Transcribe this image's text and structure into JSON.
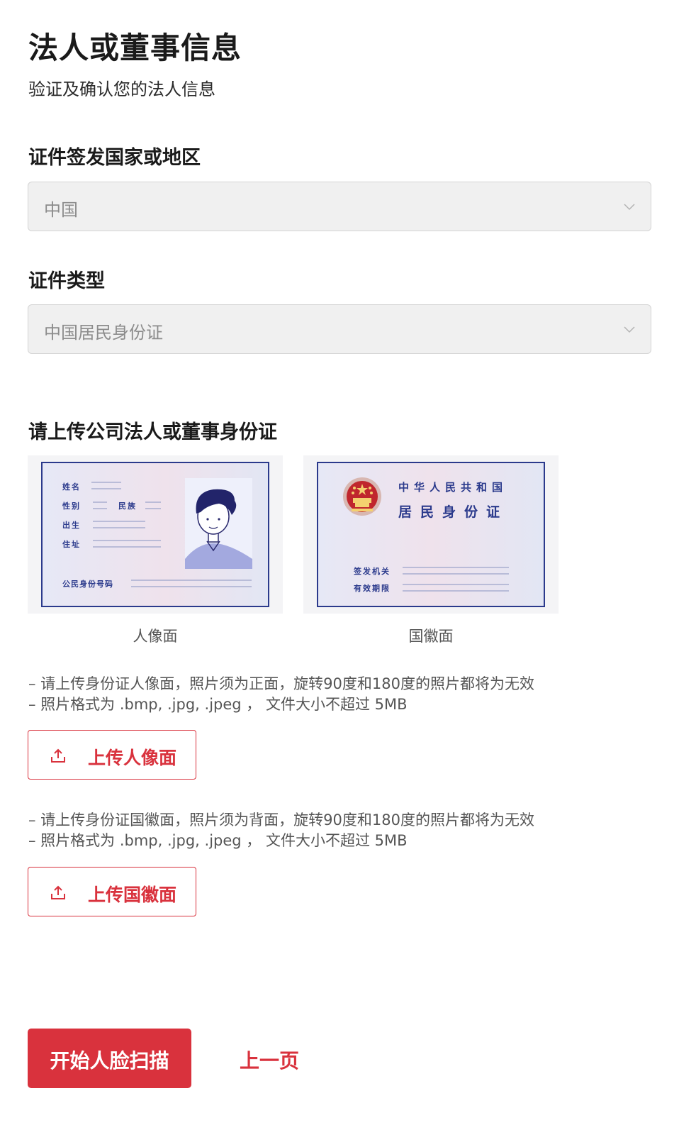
{
  "header": {
    "title": "法人或董事信息",
    "subtitle": "验证及确认您的法人信息"
  },
  "country": {
    "label": "证件签发国家或地区",
    "value": "中国"
  },
  "id_type": {
    "label": "证件类型",
    "value": "中国居民身份证"
  },
  "upload": {
    "heading": "请上传公司法人或董事身份证",
    "front_card": {
      "caption": "人像面",
      "fields": {
        "name": "姓名",
        "gender": "性别",
        "ethnicity": "民族",
        "birth": "出生",
        "address": "住址",
        "id_number": "公民身份号码"
      }
    },
    "back_card": {
      "caption": "国徽面",
      "title_line1": "中华人民共和国",
      "title_line2": "居民身份证",
      "fields": {
        "authority": "签发机关",
        "validity": "有效期限"
      }
    },
    "front_notes": [
      "– 请上传身份证人像面，照片须为正面，旋转90度和180度的照片都将为无效",
      "– 照片格式为 .bmp, .jpg, .jpeg ， 文件大小不超过 5MB"
    ],
    "front_button": "上传人像面",
    "back_notes": [
      "– 请上传身份证国徽面，照片须为背面，旋转90度和180度的照片都将为无效",
      "– 照片格式为 .bmp, .jpg, .jpeg ， 文件大小不超过 5MB"
    ],
    "back_button": "上传国徽面"
  },
  "footer": {
    "primary_button": "开始人脸扫描",
    "back_link": "上一页"
  },
  "colors": {
    "accent": "#d9323d",
    "card_border": "#2b3a8c"
  }
}
